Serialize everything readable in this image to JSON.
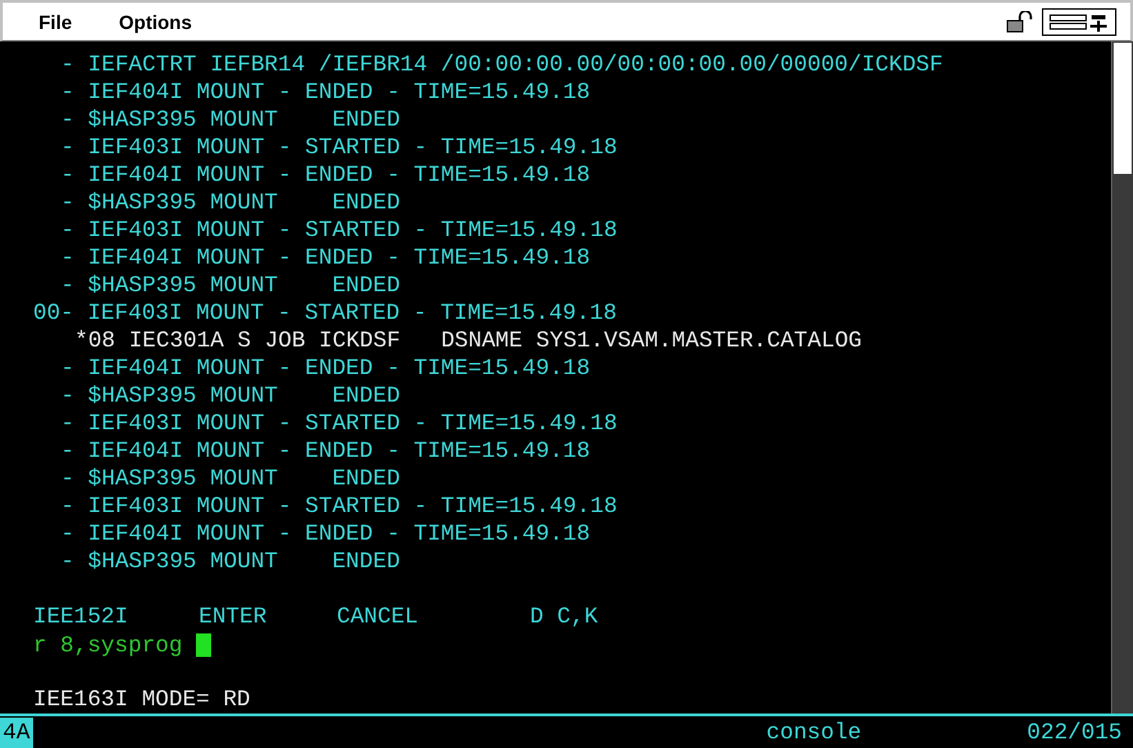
{
  "menu": [
    "File",
    "Options"
  ],
  "lines": [
    {
      "kind": "message",
      "text": "- IEFACTRT IEFBR14 /IEFBR14 /00:00:00.00/00:00:00.00/00000/ICKDSF"
    },
    {
      "kind": "message",
      "text": "- IEF404I MOUNT - ENDED - TIME=15.49.18"
    },
    {
      "kind": "message",
      "text": "- $HASP395 MOUNT    ENDED"
    },
    {
      "kind": "message",
      "text": "- IEF403I MOUNT - STARTED - TIME=15.49.18"
    },
    {
      "kind": "message",
      "text": "- IEF404I MOUNT - ENDED - TIME=15.49.18"
    },
    {
      "kind": "message",
      "text": "- $HASP395 MOUNT    ENDED"
    },
    {
      "kind": "message",
      "text": "- IEF403I MOUNT - STARTED - TIME=15.49.18"
    },
    {
      "kind": "message",
      "text": "- IEF404I MOUNT - ENDED - TIME=15.49.18"
    },
    {
      "kind": "message",
      "text": "- $HASP395 MOUNT    ENDED"
    },
    {
      "kind": "outstanding",
      "text": "00- IEF403I MOUNT - STARTED - TIME=15.49.18"
    },
    {
      "kind": "action",
      "text": "*08 IEC301A S JOB ICKDSF   DSNAME SYS1.VSAM.MASTER.CATALOG"
    },
    {
      "kind": "message",
      "text": "- IEF404I MOUNT - ENDED - TIME=15.49.18"
    },
    {
      "kind": "message",
      "text": "- $HASP395 MOUNT    ENDED"
    },
    {
      "kind": "message",
      "text": "- IEF403I MOUNT - STARTED - TIME=15.49.18"
    },
    {
      "kind": "message",
      "text": "- IEF404I MOUNT - ENDED - TIME=15.49.18"
    },
    {
      "kind": "message",
      "text": "- $HASP395 MOUNT    ENDED"
    },
    {
      "kind": "message",
      "text": "- IEF403I MOUNT - STARTED - TIME=15.49.18"
    },
    {
      "kind": "message",
      "text": "- IEF404I MOUNT - ENDED - TIME=15.49.18"
    },
    {
      "kind": "message",
      "text": "- $HASP395 MOUNT    ENDED"
    }
  ],
  "pf_keys": [
    "IEE152I",
    "ENTER",
    "CANCEL",
    "D C,K"
  ],
  "command": {
    "value": "r 8,sysprog"
  },
  "mode_line": "IEE163I MODE= RD",
  "status_bar": {
    "indicator": "4A",
    "session": "console",
    "position": "022/015"
  }
}
